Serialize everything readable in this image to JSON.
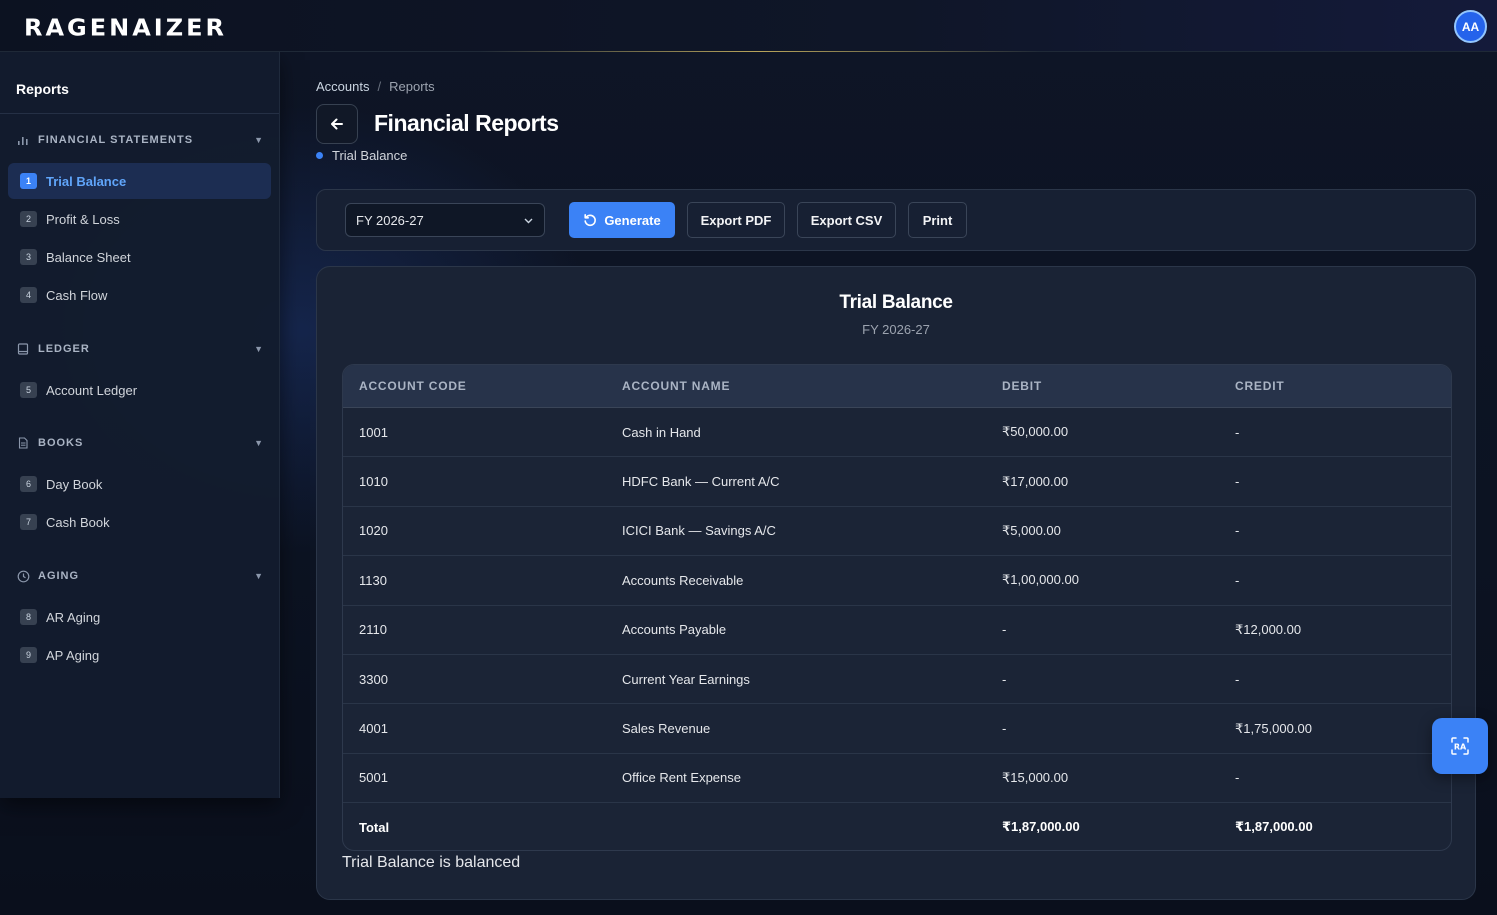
{
  "app": {
    "logo": "RAGENAIZER",
    "avatar_initials": "AA"
  },
  "sidebar": {
    "title": "Reports",
    "groups": [
      {
        "label": "FINANCIAL STATEMENTS",
        "icon": "bar-chart-icon"
      },
      {
        "label": "LEDGER",
        "icon": "book-icon"
      },
      {
        "label": "BOOKS",
        "icon": "document-icon"
      },
      {
        "label": "AGING",
        "icon": "clock-icon"
      }
    ],
    "items": [
      {
        "num": "1",
        "label": "Trial Balance",
        "active": true
      },
      {
        "num": "2",
        "label": "Profit & Loss"
      },
      {
        "num": "3",
        "label": "Balance Sheet"
      },
      {
        "num": "4",
        "label": "Cash Flow"
      },
      {
        "num": "5",
        "label": "Account Ledger"
      },
      {
        "num": "6",
        "label": "Day Book"
      },
      {
        "num": "7",
        "label": "Cash Book"
      },
      {
        "num": "8",
        "label": "AR Aging"
      },
      {
        "num": "9",
        "label": "AP Aging"
      }
    ]
  },
  "breadcrumb": {
    "parent": "Accounts",
    "separator": "/",
    "current": "Reports"
  },
  "header": {
    "title": "Financial Reports",
    "subtitle": "Trial Balance"
  },
  "toolbar": {
    "fiscal_year": "FY 2026-27",
    "generate_label": "Generate",
    "export_pdf_label": "Export PDF",
    "export_csv_label": "Export CSV",
    "print_label": "Print"
  },
  "report": {
    "title": "Trial Balance",
    "period": "FY 2026-27",
    "columns": [
      "ACCOUNT CODE",
      "ACCOUNT NAME",
      "DEBIT",
      "CREDIT"
    ],
    "rows": [
      {
        "code": "1001",
        "name": "Cash in Hand",
        "debit": "₹50,000.00",
        "credit": "-"
      },
      {
        "code": "1010",
        "name": "HDFC Bank — Current A/C",
        "debit": "₹17,000.00",
        "credit": "-"
      },
      {
        "code": "1020",
        "name": "ICICI Bank — Savings A/C",
        "debit": "₹5,000.00",
        "credit": "-"
      },
      {
        "code": "1130",
        "name": "Accounts Receivable",
        "debit": "₹1,00,000.00",
        "credit": "-"
      },
      {
        "code": "2110",
        "name": "Accounts Payable",
        "debit": "-",
        "credit": "₹12,000.00"
      },
      {
        "code": "3300",
        "name": "Current Year Earnings",
        "debit": "-",
        "credit": "-"
      },
      {
        "code": "4001",
        "name": "Sales Revenue",
        "debit": "-",
        "credit": "₹1,75,000.00"
      },
      {
        "code": "5001",
        "name": "Office Rent Expense",
        "debit": "₹15,000.00",
        "credit": "-"
      }
    ],
    "total": {
      "label": "Total",
      "debit": "₹1,87,000.00",
      "credit": "₹1,87,000.00"
    },
    "status": "Trial Balance is balanced"
  },
  "colors": {
    "accent": "#3b82f6",
    "background": "#0b1120",
    "card": "#1a2335"
  }
}
